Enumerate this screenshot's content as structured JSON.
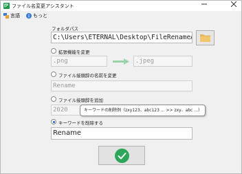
{
  "app": {
    "title": "ファイル名変更アシスタント"
  },
  "menu": {
    "language_label": "言語",
    "more_label": "もっと"
  },
  "folder": {
    "label": "フォルダパス",
    "path_value": "C:\\Users\\ETERNAL\\Desktop\\FileRenameAssis"
  },
  "options": {
    "ext_change_label": "拡張機能を変更",
    "ext_from_placeholder": ".png",
    "ext_to_placeholder": ".jpeg",
    "prefix_change_label": "ファイル接頭辞の名前を変更",
    "prefix_change_placeholder": "Rename",
    "prefix_add_label": "ファイル接頭辞を追加",
    "prefix_add_placeholder": "2020",
    "keyword_delete_label": "キーワードを削除する",
    "keyword_value": "Rename"
  },
  "tooltip": {
    "text": "キーワードの削除例（zxy123、abc123 ... >> zxy、abc ...）"
  },
  "colors": {
    "accent_green": "#2ea65a",
    "arrow_green": "#9bd3a8",
    "folder_icon": "#e3b65c"
  },
  "icons": {
    "app": "app-icon",
    "language": "language-icon",
    "more": "info-icon",
    "browse": "folder-icon",
    "arrow": "arrow-right-icon",
    "run": "checkmark-icon"
  }
}
